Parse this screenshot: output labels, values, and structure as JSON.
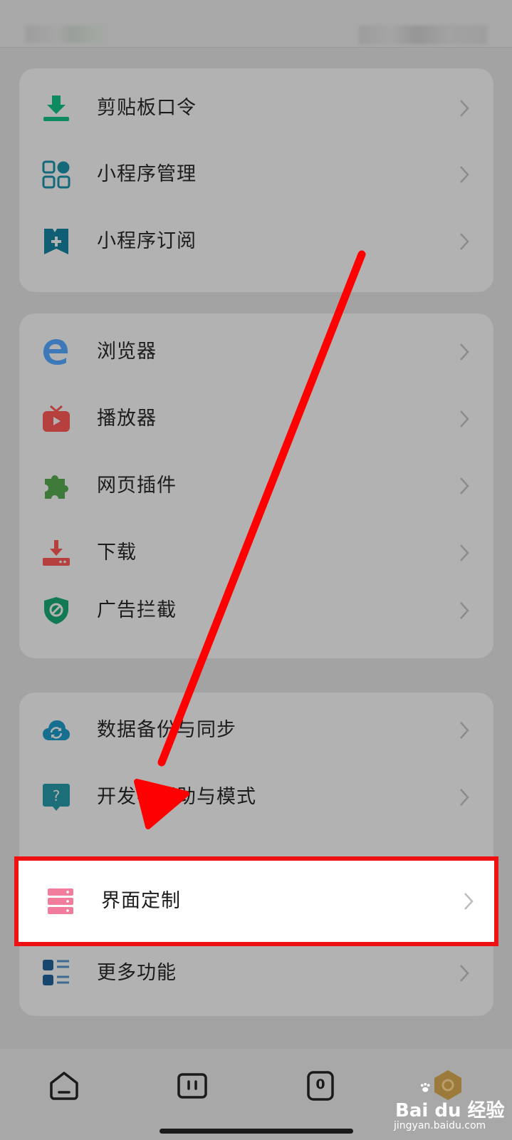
{
  "groups": [
    {
      "items": [
        {
          "label": "剪贴板口令",
          "icon": "clipboard-download-icon"
        },
        {
          "label": "小程序管理",
          "icon": "mini-program-grid-icon"
        },
        {
          "label": "小程序订阅",
          "icon": "bookmark-plus-icon"
        }
      ]
    },
    {
      "items": [
        {
          "label": "浏览器",
          "icon": "browser-e-icon"
        },
        {
          "label": "播放器",
          "icon": "tv-player-icon"
        },
        {
          "label": "网页插件",
          "icon": "puzzle-icon"
        },
        {
          "label": "下载",
          "icon": "download-tray-icon"
        },
        {
          "label": "广告拦截",
          "icon": "shield-block-icon"
        }
      ]
    },
    {
      "items": [
        {
          "label": "数据备份与同步",
          "icon": "cloud-sync-icon"
        },
        {
          "label": "开发者帮助与模式",
          "icon": "help-bubble-icon"
        },
        {
          "label": "界面定制",
          "icon": "interface-layers-icon"
        },
        {
          "label": "更多功能",
          "icon": "more-list-icon"
        }
      ]
    }
  ],
  "bottom_nav": [
    {
      "icon": "home-icon"
    },
    {
      "icon": "tabs-icon"
    },
    {
      "icon": "counter-icon",
      "count": "0"
    },
    {
      "icon": "profile-hexagon-icon"
    }
  ],
  "watermark": {
    "brand": "Bai du 经验",
    "url": "jingyan.baidu.com"
  },
  "colors": {
    "highlight_border": "#ee1111",
    "arrow": "#ff0000"
  }
}
